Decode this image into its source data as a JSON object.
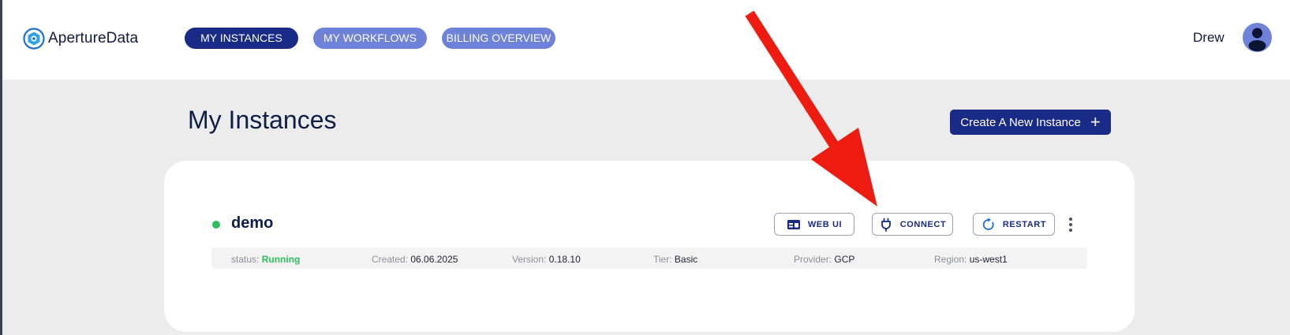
{
  "app": {
    "logo_text": "ApertureData"
  },
  "nav": {
    "tabs": [
      {
        "label": "MY INSTANCES",
        "active": true
      },
      {
        "label": "MY WORKFLOWS",
        "active": false
      },
      {
        "label": "BILLING OVERVIEW",
        "active": false
      }
    ]
  },
  "user": {
    "name": "Drew",
    "avatar_icon": "user-avatar-icon"
  },
  "page": {
    "title": "My Instances",
    "create_button_label": "Create A New Instance",
    "create_button_icon": "plus-icon"
  },
  "instance": {
    "name": "demo",
    "status_color": "#2bbf5e",
    "actions": [
      {
        "label": "WEB UI",
        "icon": "browser-window-icon"
      },
      {
        "label": "CONNECT",
        "icon": "plug-icon"
      },
      {
        "label": "RESTART",
        "icon": "refresh-icon"
      }
    ],
    "more_icon": "kebab-menu-icon",
    "details": {
      "status_label": "status:",
      "status_value": "Running",
      "created_label": "Created:",
      "created_value": "06.06.2025",
      "version_label": "Version:",
      "version_value": "0.18.10",
      "tier_label": "Tier:",
      "tier_value": "Basic",
      "provider_label": "Provider:",
      "provider_value": "GCP",
      "region_label": "Region:",
      "region_value": "us-west1"
    }
  },
  "annotation": {
    "arrow_color": "#ee1c10",
    "points_to": "connect-button"
  },
  "colors": {
    "primary": "#1a2a87",
    "nav_inactive": "#6d82d8",
    "running": "#2bbf5e",
    "background": "#ececec"
  }
}
